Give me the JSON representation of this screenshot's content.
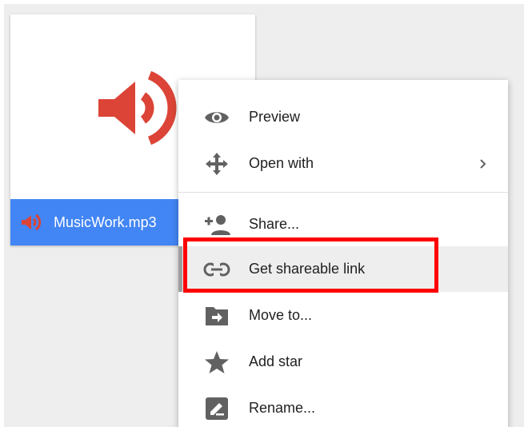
{
  "file": {
    "name": "MusicWork.mp3",
    "type_icon": "audio-icon",
    "icon_color": "#db4437",
    "bar_color": "#4285f4"
  },
  "menu": {
    "items": [
      {
        "label": "Preview",
        "icon": "eye-icon"
      },
      {
        "label": "Open with",
        "icon": "move-arrows-icon",
        "submenu": true
      },
      {
        "label": "Share...",
        "icon": "person-add-icon"
      },
      {
        "label": "Get shareable link",
        "icon": "link-icon",
        "active": true
      },
      {
        "label": "Move to...",
        "icon": "folder-move-icon"
      },
      {
        "label": "Add star",
        "icon": "star-icon"
      },
      {
        "label": "Rename...",
        "icon": "rename-icon"
      }
    ]
  },
  "annotation": {
    "highlight_color": "#ff0000"
  }
}
